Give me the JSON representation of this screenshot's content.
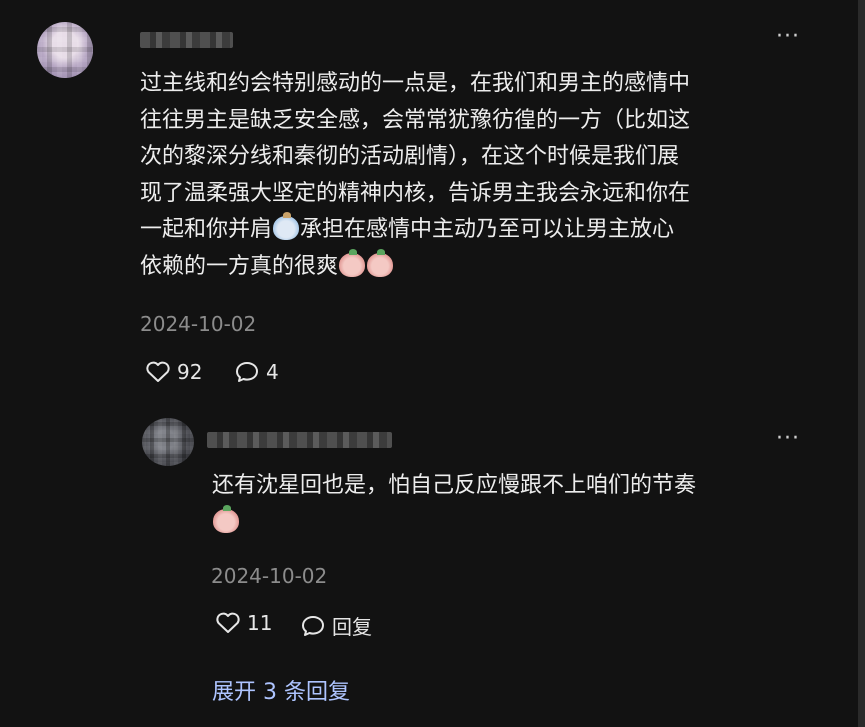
{
  "comment": {
    "text_line1": "过主线和约会特别感动的一点是，在我们和男主的感情中",
    "text_line2": "往往男主是缺乏安全感，会常常犹豫彷徨的一方（比如这",
    "text_line3": "次的黎深分线和秦彻的活动剧情），在这个时候是我们展",
    "text_line4": "现了温柔强大坚定的精神内核，告诉男主我会永远和你在",
    "text_line5a": "一起和你并肩",
    "text_line5b": "承担在感情中主动乃至可以让男主放心",
    "text_line6": "依赖的一方真的很爽",
    "date": "2024-10-02",
    "likes": "92",
    "comments": "4",
    "more_label": "···"
  },
  "reply": {
    "text_line1": "还有沈星回也是，怕自己反应慢跟不上咱们的节奏",
    "date": "2024-10-02",
    "likes": "11",
    "reply_label": "回复",
    "more_label": "···"
  },
  "expand_label": "展开 3 条回复",
  "icons": {
    "like": "heart-outline-icon",
    "comment": "speech-bubble-icon",
    "emoji_cry": "crying-emoji-icon",
    "emoji_pray": "pray-sticker-icon"
  },
  "colors": {
    "background": "#121212",
    "text": "#ededed",
    "secondary": "#8c8c8c",
    "link": "#aec4ff"
  }
}
